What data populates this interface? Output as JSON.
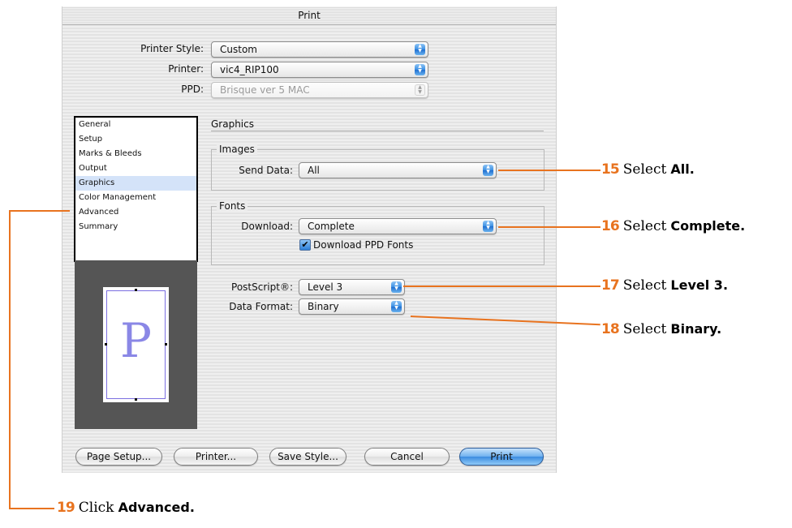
{
  "dialog": {
    "title": "Print",
    "printer_style_label": "Printer Style:",
    "printer_style_value": "Custom",
    "printer_label": "Printer:",
    "printer_value": "vic4_RIP100",
    "ppd_label": "PPD:",
    "ppd_value": "Brisque ver 5 MAC"
  },
  "categories": [
    {
      "label": "General"
    },
    {
      "label": "Setup"
    },
    {
      "label": "Marks & Bleeds"
    },
    {
      "label": "Output"
    },
    {
      "label": "Graphics"
    },
    {
      "label": "Color Management"
    },
    {
      "label": "Advanced"
    },
    {
      "label": "Summary"
    }
  ],
  "selected_category": "Graphics",
  "graphics": {
    "section_title": "Graphics",
    "images_group": "Images",
    "send_data_label": "Send Data:",
    "send_data_value": "All",
    "fonts_group": "Fonts",
    "download_label": "Download:",
    "download_value": "Complete",
    "download_ppd_fonts_label": "Download PPD Fonts",
    "download_ppd_fonts_checked": true,
    "postscript_label": "PostScript®:",
    "postscript_value": "Level 3",
    "data_format_label": "Data Format:",
    "data_format_value": "Binary"
  },
  "preview": {
    "letter": "P"
  },
  "buttons": {
    "page_setup": "Page Setup...",
    "printer": "Printer...",
    "save_style": "Save Style...",
    "cancel": "Cancel",
    "print": "Print"
  },
  "callouts": [
    {
      "number": "15",
      "verb": "Select",
      "object": "All."
    },
    {
      "number": "16",
      "verb": "Select",
      "object": "Complete."
    },
    {
      "number": "17",
      "verb": "Select",
      "object": "Level 3."
    },
    {
      "number": "18",
      "verb": "Select",
      "object": "Binary."
    },
    {
      "number": "19",
      "verb": "Click",
      "object": "Advanced."
    }
  ],
  "colors": {
    "callout_accent": "#e8731f",
    "selection_highlight": "#d4e3f9",
    "aqua_blue": "#3a8fe3"
  }
}
